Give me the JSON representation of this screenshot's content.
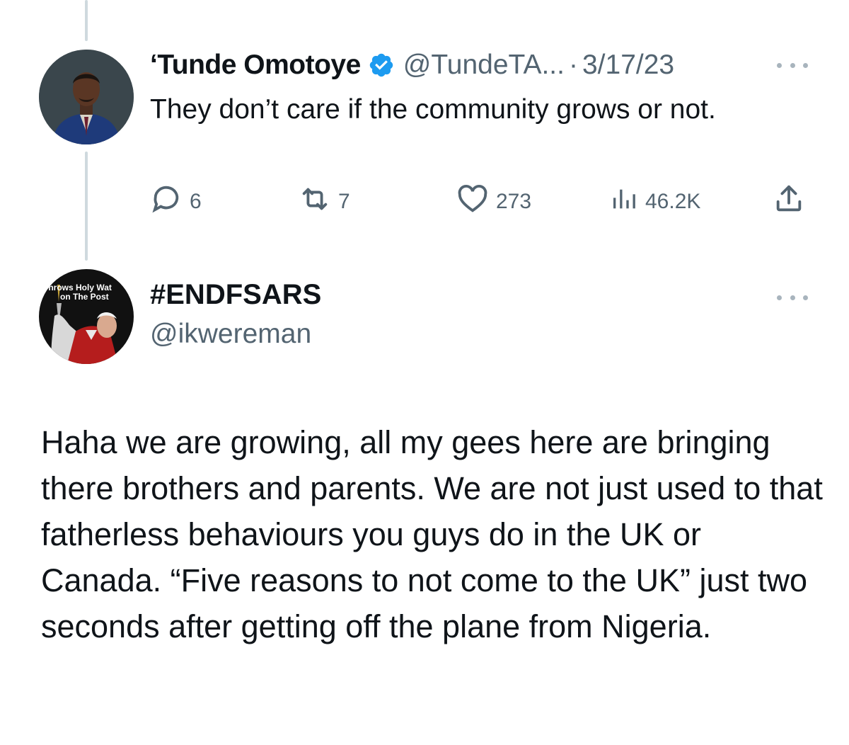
{
  "tweet1": {
    "display_name": "‘Tunde Omotoye",
    "handle": "@TundeTA...",
    "separator": "·",
    "date": "3/17/23",
    "text": "They don’t care if the community grows or not.",
    "replies": "6",
    "retweets": "7",
    "likes": "273",
    "views": "46.2K"
  },
  "tweet2": {
    "display_name": "#ENDFSARS",
    "handle": "@ikwereman",
    "avatar_caption_line1": "Throws Holy Wat",
    "avatar_caption_line2": "on The Post",
    "text": "Haha we are growing, all my gees here are bringing there brothers and parents. We are not just used to that fatherless behaviours you guys do in the UK or Canada. “Five reasons to not come to the UK” just two seconds after getting off the plane from Nigeria."
  },
  "colors": {
    "text_primary": "#0f1419",
    "text_secondary": "#536471",
    "verified_blue": "#1d9bf0",
    "thread_line": "#cfd9de"
  },
  "icons": {
    "verified": "verified-badge-icon",
    "more": "more-options-icon",
    "reply": "reply-icon",
    "retweet": "retweet-icon",
    "like": "heart-icon",
    "views": "views-icon",
    "share": "share-icon"
  }
}
